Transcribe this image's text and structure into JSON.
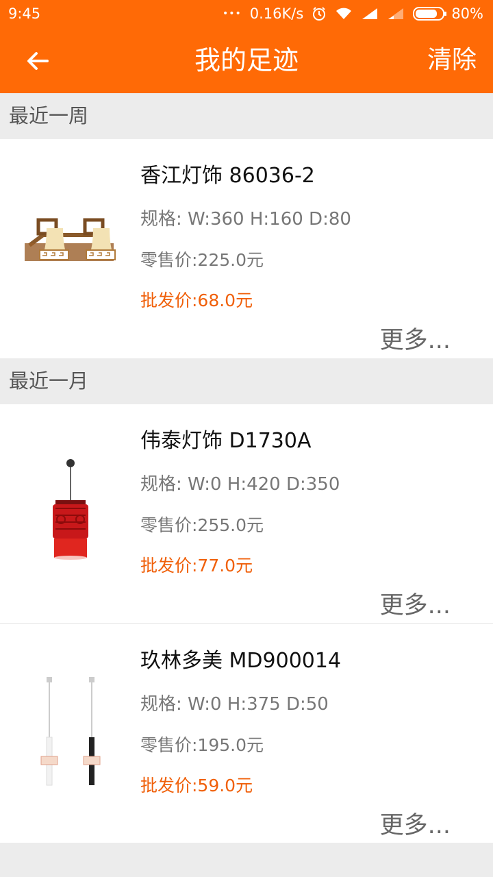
{
  "status": {
    "time": "9:45",
    "dots": "•••",
    "speed": "0.16K/s",
    "battery": "80%",
    "icons": [
      "alarm-icon",
      "wifi-icon",
      "signal-icon",
      "signal-weak-icon",
      "battery-icon"
    ]
  },
  "appbar": {
    "title": "我的足迹",
    "clear_label": "清除",
    "back_icon": "arrow-left-icon"
  },
  "sections": [
    {
      "title": "最近一周",
      "items": [
        {
          "name": "香江灯饰 86036-2",
          "spec": "规格: W:360 H:160 D:80",
          "retail": "零售价:225.0元",
          "wholesale": "批发价:68.0元",
          "more": "更多..."
        }
      ]
    },
    {
      "title": "最近一月",
      "items": [
        {
          "name": "伟泰灯饰 D1730A",
          "spec": "规格: W:0 H:420 D:350",
          "retail": "零售价:255.0元",
          "wholesale": "批发价:77.0元",
          "more": "更多..."
        },
        {
          "name": "玖林多美 MD900014",
          "spec": "规格: W:0 H:375 D:50",
          "retail": "零售价:195.0元",
          "wholesale": "批发价:59.0元",
          "more": "更多..."
        }
      ]
    }
  ],
  "colors": {
    "brand": "#ff6a06",
    "wholesale": "#f0600a",
    "background": "#ececec"
  }
}
